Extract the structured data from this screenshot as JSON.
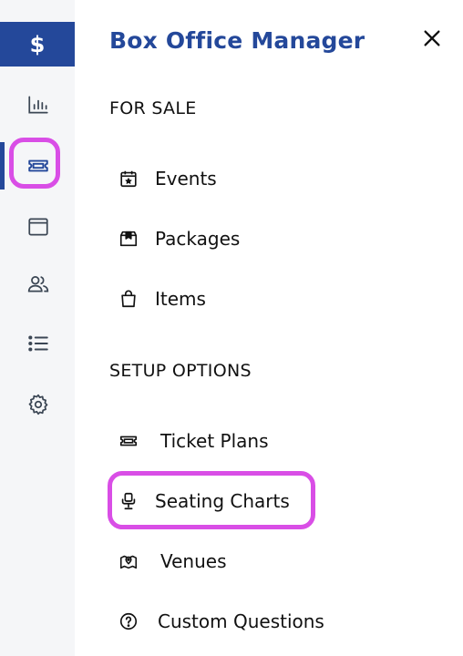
{
  "rail": {
    "logo_symbol": "$",
    "items": [
      {
        "icon": "bar-chart-icon"
      },
      {
        "icon": "ticket-icon"
      },
      {
        "icon": "browser-window-icon"
      },
      {
        "icon": "users-icon"
      },
      {
        "icon": "list-icon"
      },
      {
        "icon": "gear-icon"
      }
    ],
    "active_index": 1,
    "accent": "#24489a",
    "highlight": "#d94ee6"
  },
  "panel": {
    "title": "Box Office Manager",
    "close_icon": "close-icon",
    "sections": [
      {
        "label": "FOR SALE",
        "items": [
          {
            "label": "Events",
            "icon": "calendar-star-icon"
          },
          {
            "label": "Packages",
            "icon": "package-icon"
          },
          {
            "label": "Items",
            "icon": "shopping-bag-icon"
          }
        ]
      },
      {
        "label": "SETUP OPTIONS",
        "items": [
          {
            "label": "Ticket Plans",
            "icon": "ticket-icon"
          },
          {
            "label": "Seating Charts",
            "icon": "seat-icon"
          },
          {
            "label": "Venues",
            "icon": "map-pin-icon"
          },
          {
            "label": "Custom Questions",
            "icon": "question-circle-icon"
          }
        ]
      }
    ]
  }
}
